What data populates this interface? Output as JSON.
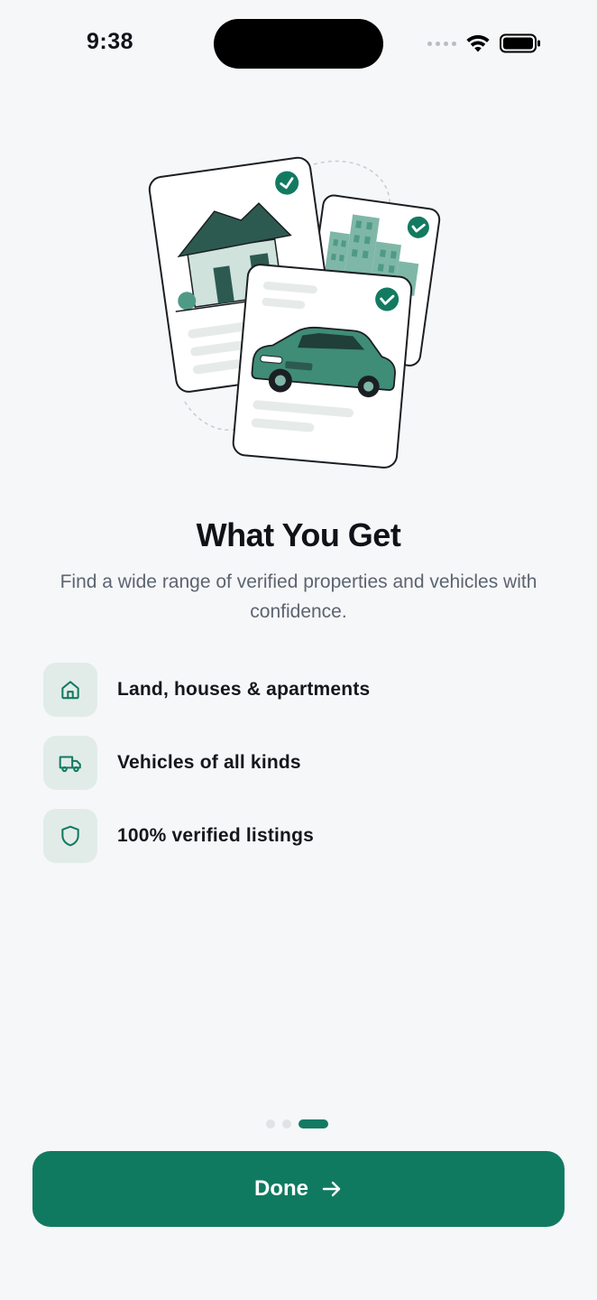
{
  "status_bar": {
    "time": "9:38"
  },
  "onboarding": {
    "title": "What You Get",
    "subtitle": "Find a wide range of verified properties and vehicles with confidence.",
    "features": [
      {
        "label": "Land, houses & apartments",
        "icon": "home-icon"
      },
      {
        "label": "Vehicles of all kinds",
        "icon": "truck-icon"
      },
      {
        "label": "100% verified listings",
        "icon": "shield-icon"
      }
    ],
    "pager": {
      "total": 3,
      "current": 3
    },
    "done_label": "Done"
  },
  "colors": {
    "accent": "#107a61",
    "icon_bg": "#e1ece8",
    "background": "#f6f7f9"
  }
}
